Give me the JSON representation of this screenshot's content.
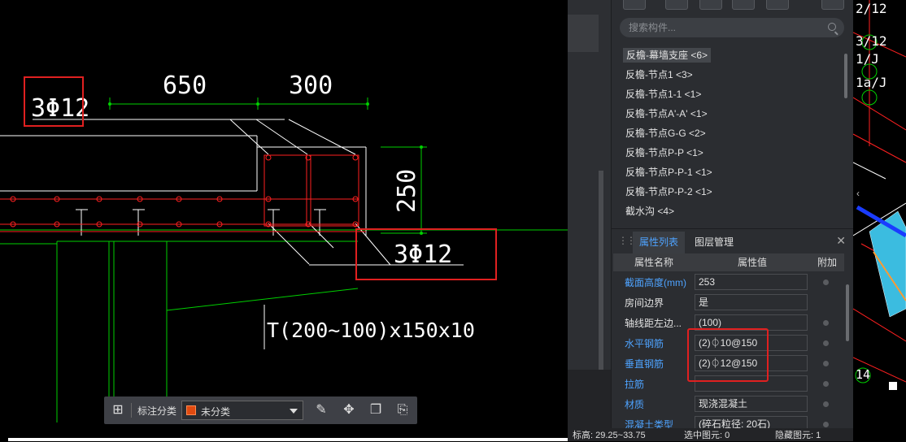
{
  "drawing": {
    "dim_650": "650",
    "dim_300": "300",
    "dim_250": "250",
    "rebar_top": "3Φ12",
    "rebar_bottom": "3Φ12",
    "section_label": "T(200~100)x150x10",
    "right_labels": [
      "2/12",
      "3/12",
      "1/J",
      "1a/J",
      "14"
    ]
  },
  "search": {
    "placeholder": "搜索构件..."
  },
  "component_list": [
    "反檐-幕墙支座 <6>",
    "反檐-节点1 <3>",
    "反檐-节点1-1 <1>",
    "反檐-节点A'-A' <1>",
    "反檐-节点G-G <2>",
    "反檐-节点P-P <1>",
    "反檐-节点P-P-1 <1>",
    "反檐-节点P-P-2 <1>",
    "截水沟 <4>"
  ],
  "tabs": {
    "properties": "属性列表",
    "layers": "图层管理"
  },
  "table_header": {
    "name": "属性名称",
    "value": "属性值",
    "extra": "附加"
  },
  "properties": [
    {
      "name": "截面高度(mm)",
      "value": "253"
    },
    {
      "name": "房间边界",
      "value": "是"
    },
    {
      "name": "轴线距左边...",
      "value": "(100)"
    },
    {
      "name": "水平钢筋",
      "value": "(2)⏀10@150"
    },
    {
      "name": "垂直钢筋",
      "value": "(2)⏀12@150"
    },
    {
      "name": "拉筋",
      "value": ""
    },
    {
      "name": "材质",
      "value": "现浇混凝土"
    },
    {
      "name": "混凝土类型",
      "value": "(碎石粒径: 20石)"
    }
  ],
  "status": {
    "elevation": "标高: 29.25~33.75",
    "selected": "选中图元: 0",
    "hidden": "隐藏图元: 1"
  },
  "float_toolbar": {
    "label": "标注分类",
    "category": "未分类"
  },
  "colors": {
    "accent": "#4ea3ff",
    "highlight": "#e02020",
    "cad_green": "#00e000",
    "cad_red": "#ff2020"
  }
}
